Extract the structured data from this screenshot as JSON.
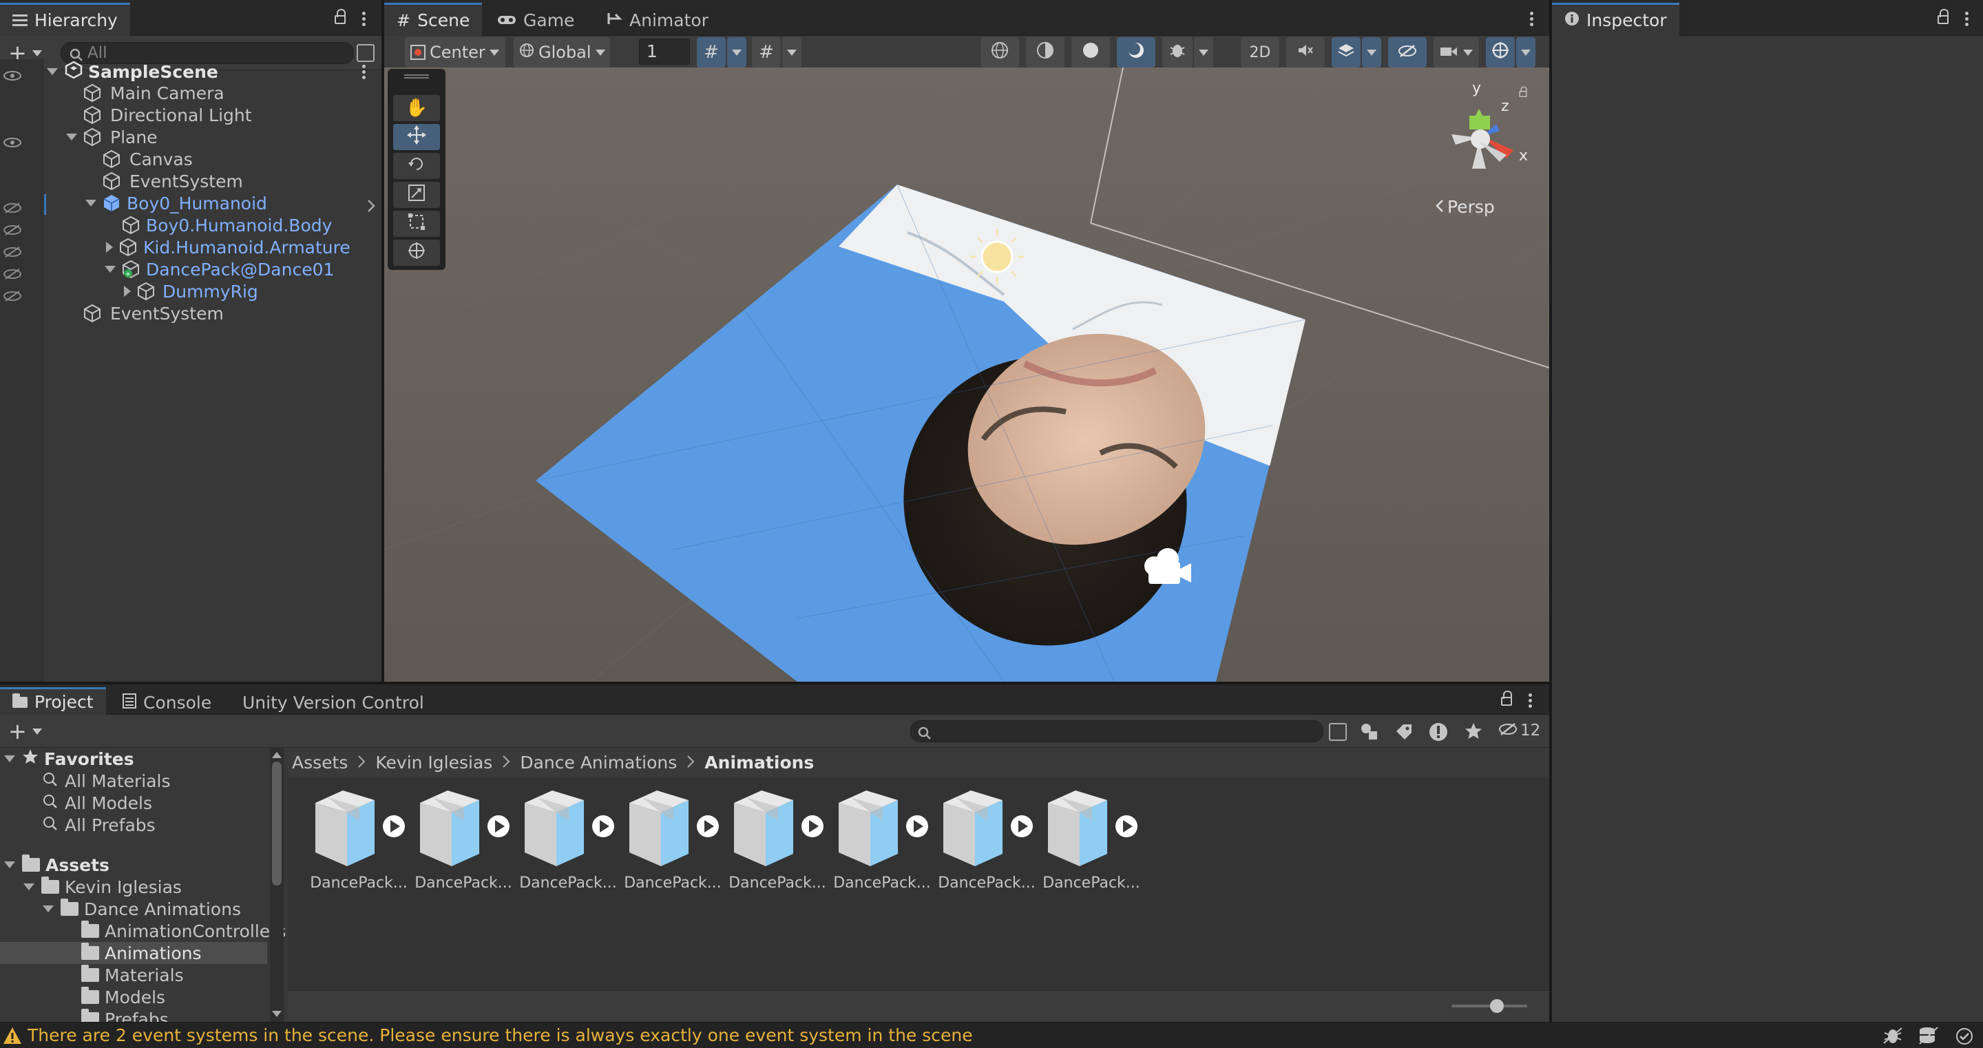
{
  "hierarchy": {
    "tab_label": "Hierarchy",
    "search_placeholder": "All",
    "scene_name": "SampleScene",
    "items": [
      {
        "label": "Main Camera"
      },
      {
        "label": "Directional Light"
      },
      {
        "label": "Plane"
      },
      {
        "label": "Canvas"
      },
      {
        "label": "EventSystem"
      },
      {
        "label": "Boy0_Humanoid"
      },
      {
        "label": "Boy0.Humanoid.Body"
      },
      {
        "label": "Kid.Humanoid.Armature"
      },
      {
        "label": "DancePack@Dance01"
      },
      {
        "label": "DummyRig"
      },
      {
        "label": "EventSystem"
      }
    ]
  },
  "scene": {
    "tabs": [
      {
        "label": "Scene",
        "icon": "grid-icon"
      },
      {
        "label": "Game",
        "icon": "gamepad-icon"
      },
      {
        "label": "Animator",
        "icon": "animator-icon"
      }
    ],
    "pivot_mode": "Center",
    "pivot_rotation": "Global",
    "grid_snap_value": "1",
    "toggle_2d": "2D",
    "view_label": "Persp",
    "gizmo_axes": {
      "y": "y",
      "z": "z",
      "x": "x"
    }
  },
  "inspector": {
    "tab_label": "Inspector"
  },
  "project": {
    "tabs": [
      {
        "label": "Project"
      },
      {
        "label": "Console"
      },
      {
        "label": "Unity Version Control"
      }
    ],
    "hidden_count": "12",
    "favorites_label": "Favorites",
    "favorites": [
      {
        "label": "All Materials"
      },
      {
        "label": "All Models"
      },
      {
        "label": "All Prefabs"
      }
    ],
    "assets_label": "Assets",
    "folders": [
      {
        "label": "Kevin Iglesias"
      },
      {
        "label": "Dance Animations"
      },
      {
        "label": "AnimationControllers"
      },
      {
        "label": "Animations"
      },
      {
        "label": "Materials"
      },
      {
        "label": "Models"
      },
      {
        "label": "Prefabs"
      }
    ],
    "breadcrumb": [
      "Assets",
      "Kevin Iglesias",
      "Dance Animations",
      "Animations"
    ],
    "assets": [
      {
        "label": "DancePack..."
      },
      {
        "label": "DancePack..."
      },
      {
        "label": "DancePack..."
      },
      {
        "label": "DancePack..."
      },
      {
        "label": "DancePack..."
      },
      {
        "label": "DancePack..."
      },
      {
        "label": "DancePack..."
      },
      {
        "label": "DancePack..."
      }
    ]
  },
  "status": {
    "message": "There are 2 event systems in the scene. Please ensure there is always exactly one event system in the scene"
  },
  "colors": {
    "accent": "#3a79bb",
    "selection": "#46607c",
    "prefab_text": "#7fb0ff",
    "warning": "#e8b23a"
  }
}
